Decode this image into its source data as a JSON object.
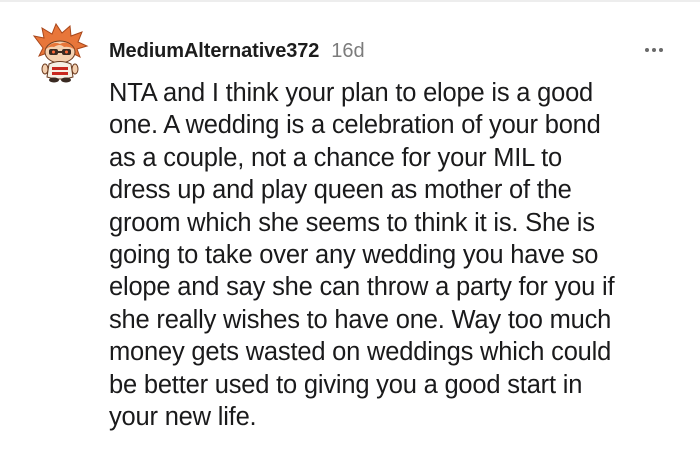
{
  "comment": {
    "author": "MediumAlternative372",
    "age": "16d",
    "avatar_icon": "snoo-avatar-icon",
    "more_icon": "more-options-icon",
    "body_lines": [
      "NTA and I think your plan to elope is a good",
      "one. A wedding is a celebration of your bond",
      "as a couple, not a chance for your MIL to",
      "dress up and play queen as mother of the",
      "groom which she seems to think it is. She is",
      "going to take over any wedding you have so",
      "elope and say she can throw a party for you if",
      "she really wishes to have one. Way too much",
      "money gets wasted on weddings which could",
      "be better used to giving you a good start in",
      "your new life."
    ]
  },
  "colors": {
    "username": "#1c1c1c",
    "meta_gray": "#7c7c7c",
    "body_text": "#1a1a1b",
    "avatar_orange": "#e8763a"
  }
}
